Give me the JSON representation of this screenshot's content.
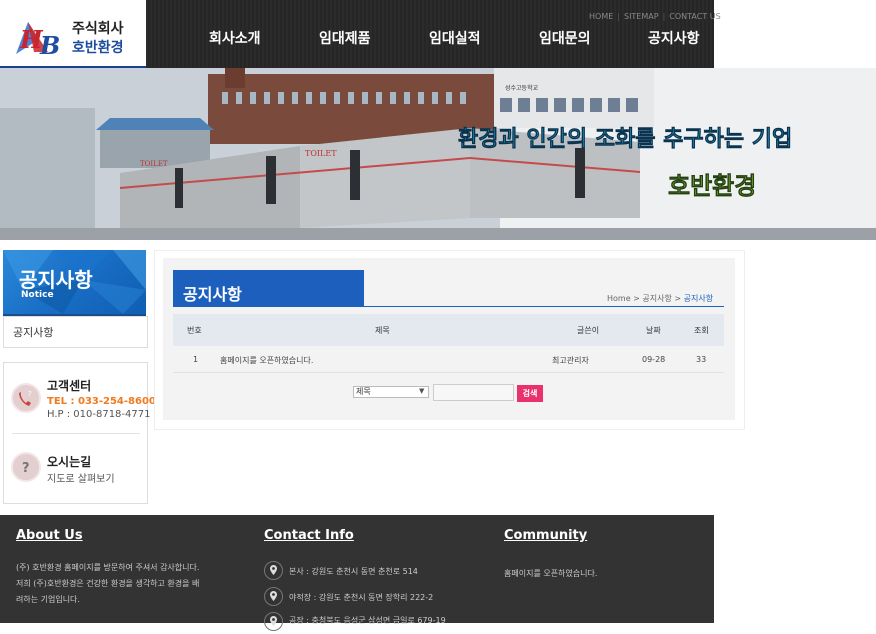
{
  "brand": {
    "logo_letters": "HB",
    "company_type": "주식회사",
    "company_name": "호반환경"
  },
  "nav": {
    "items": [
      "회사소개",
      "임대제품",
      "임대실적",
      "임대문의",
      "공지사항"
    ],
    "util": [
      "HOME",
      "SITEMAP",
      "CONTACT US"
    ]
  },
  "hero": {
    "school_sign": "성수고등학교",
    "toilet_label": "TOILET",
    "slogan": "환경과 인간의 조화를 추구하는 기업",
    "slogan_brand": "호반환경"
  },
  "sidebar": {
    "title": "공지사항",
    "subtitle": "Notice",
    "link": "공지사항",
    "support_title": "고객센터",
    "tel": "TEL : 033-254-8600",
    "hp": "H.P : 010-8718-4771",
    "map_title": "오시는길",
    "map_sub": "지도로 살펴보기"
  },
  "content": {
    "tab_title": "공지사항",
    "breadcrumb": [
      "Home",
      "공지사항",
      "공지사항"
    ],
    "table": {
      "headers": [
        "번호",
        "제목",
        "글쓴이",
        "날짜",
        "조회"
      ],
      "rows": [
        {
          "no": "1",
          "title": "홈페이지를 오픈하였습니다.",
          "author": "최고관리자",
          "date": "09-28",
          "views": "33"
        }
      ]
    },
    "search": {
      "select_value": "제목",
      "input_value": "",
      "button_label": "검색"
    }
  },
  "footer": {
    "about_title": "About Us",
    "about_lines": [
      "(주) 호반환경 홈페이지를 방문하여 주셔서 감사합니다.",
      "저희 (주)호반환경은 건강한 환경을 생각하고 환경을 배",
      "려하는 기업입니다."
    ],
    "contact_title": "Contact Info",
    "contact_lines": [
      "본사 : 강원도 춘천시 동면 춘천로 514",
      "야적장 : 강원도 춘천시 동면 장학리 222-2",
      "공장 : 충청북도 음성군 삼성면 금일로 679-19"
    ],
    "community_title": "Community",
    "community_lines": [
      "홈페이지를 오픈하였습니다."
    ]
  },
  "colors": {
    "brand_blue": "#1d5fbd",
    "brand_red": "#c8252c",
    "nav_bg": "#262626",
    "footer_bg": "#333333",
    "search_button": "#e8316d",
    "tel_orange": "#f07a1e",
    "slogan_cyan": "#35c4e8",
    "slogan_green": "#9bd54a"
  }
}
